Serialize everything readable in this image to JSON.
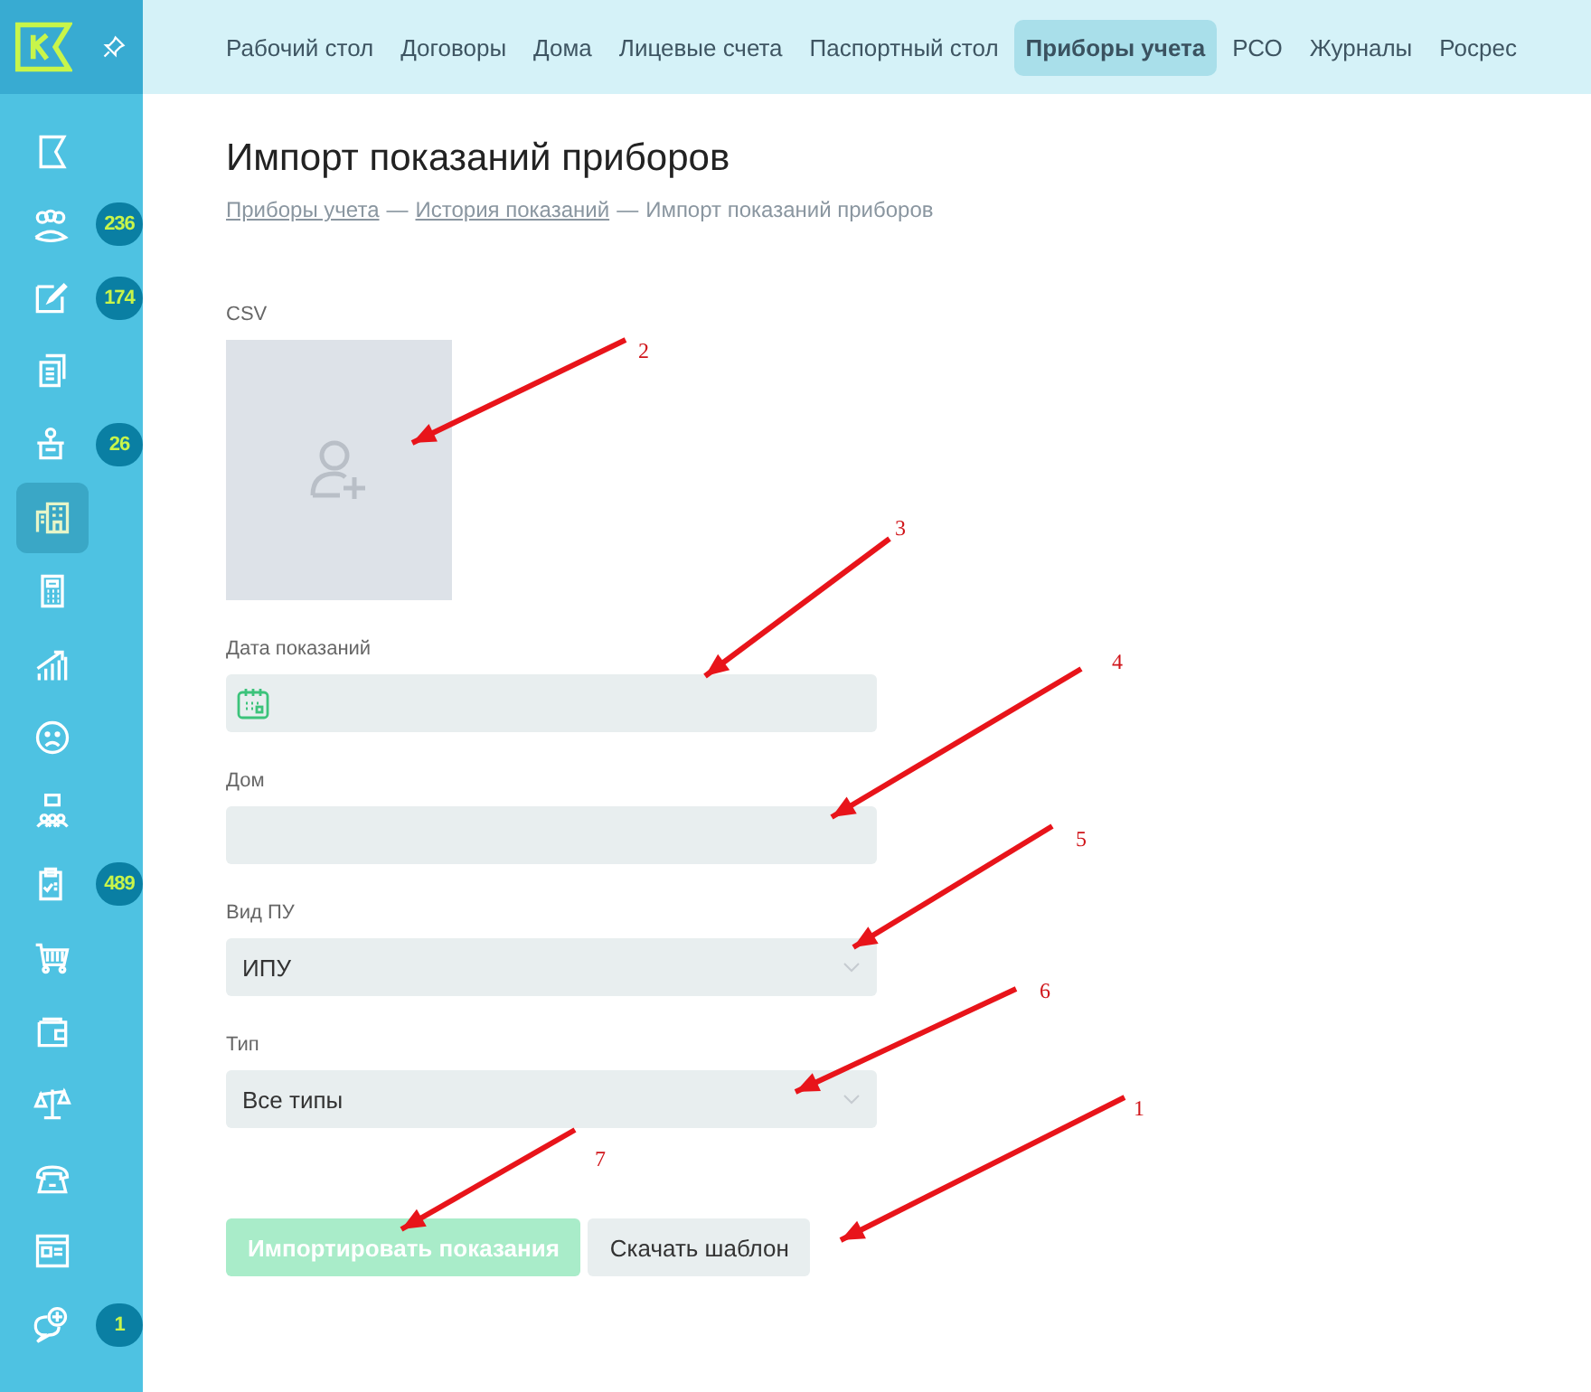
{
  "nav": {
    "items": [
      {
        "label": "Рабочий стол",
        "selected": false
      },
      {
        "label": "Договоры",
        "selected": false
      },
      {
        "label": "Дома",
        "selected": false
      },
      {
        "label": "Лицевые счета",
        "selected": false
      },
      {
        "label": "Паспортный стол",
        "selected": false
      },
      {
        "label": "Приборы учета",
        "selected": true
      },
      {
        "label": "РСО",
        "selected": false
      },
      {
        "label": "Журналы",
        "selected": false
      },
      {
        "label": "Росрес",
        "selected": false
      }
    ]
  },
  "sidebar": {
    "items": [
      {
        "selected": false
      },
      {
        "selected": false,
        "badge": "236"
      },
      {
        "selected": false,
        "badge": "174"
      },
      {
        "selected": false
      },
      {
        "selected": false,
        "badge": "26"
      },
      {
        "selected": true
      },
      {
        "selected": false
      },
      {
        "selected": false
      },
      {
        "selected": false
      },
      {
        "selected": false
      },
      {
        "selected": false,
        "badge": "489"
      },
      {
        "selected": false
      },
      {
        "selected": false
      },
      {
        "selected": false
      },
      {
        "selected": false
      },
      {
        "selected": false
      },
      {
        "selected": false,
        "badge": "1"
      }
    ]
  },
  "page": {
    "title": "Импорт показаний приборов",
    "breadcrumbs": [
      {
        "label": "Приборы учета",
        "kind": "link"
      },
      {
        "label": "История показаний",
        "kind": "link"
      },
      {
        "label": "Импорт показаний приборов",
        "kind": "current"
      }
    ],
    "separator": "—"
  },
  "form": {
    "fields": [
      {
        "label": "CSV",
        "kind": "upload"
      },
      {
        "label": "Дата показаний",
        "kind": "date"
      },
      {
        "label": "Дом",
        "kind": "text"
      },
      {
        "label": "Вид ПУ",
        "kind": "select",
        "value": "ИПУ"
      },
      {
        "label": "Тип",
        "kind": "select",
        "value": "Все типы"
      }
    ],
    "buttons": [
      {
        "label": "Импортировать показания",
        "kind": "primary",
        "disabled": true
      },
      {
        "label": "Скачать шаблон",
        "kind": "secondary",
        "disabled": false
      }
    ]
  },
  "annotations": [
    {
      "label": "1"
    },
    {
      "label": "2"
    },
    {
      "label": "3"
    },
    {
      "label": "4"
    },
    {
      "label": "5"
    },
    {
      "label": "6"
    },
    {
      "label": "7"
    }
  ]
}
